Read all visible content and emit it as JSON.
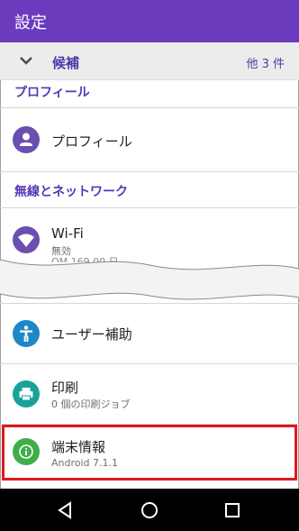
{
  "app": {
    "title": "設定"
  },
  "suggestions": {
    "label": "候補",
    "more": "他 3 件",
    "toggle_icon": "chevron-down-icon"
  },
  "sections": {
    "profile": "プロフィール",
    "network": "無線とネットワーク"
  },
  "items": {
    "profile": {
      "title": "プロフィール",
      "icon": "person-icon",
      "color": "#6a4fb0"
    },
    "wifi": {
      "title": "Wi-Fi",
      "summary": "無効",
      "icon": "wifi-icon",
      "color": "#6a4fb0"
    },
    "cut_text": "OM 169.00 日",
    "accessibility": {
      "title": "ユーザー補助",
      "icon": "accessibility-icon",
      "color": "#1e88c7"
    },
    "printing": {
      "title": "印刷",
      "summary": "0 個の印刷ジョブ",
      "icon": "print-icon",
      "color": "#17a39b"
    },
    "about": {
      "title": "端末情報",
      "summary": "Android 7.1.1",
      "icon": "info-icon",
      "color": "#3fae48"
    }
  },
  "highlight_color": "#e0191f",
  "nav": {
    "back_icon": "back-icon",
    "home_icon": "home-icon",
    "recents_icon": "recents-icon"
  }
}
